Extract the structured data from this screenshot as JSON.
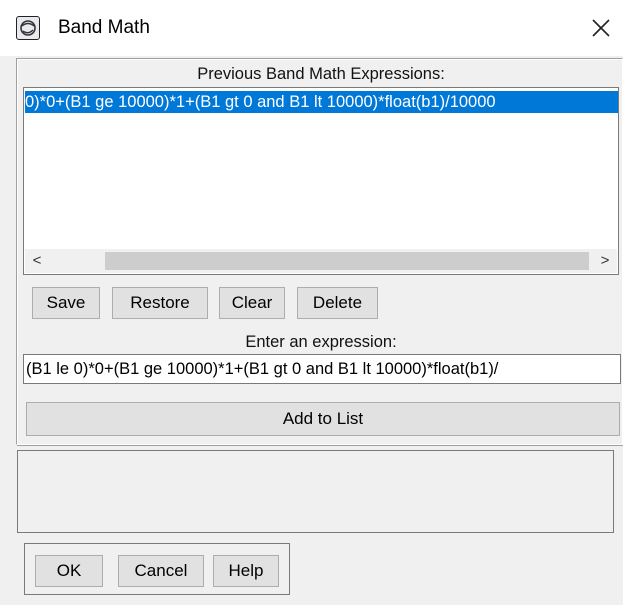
{
  "window": {
    "title": "Band Math",
    "icons": {
      "app": "band-math-app-icon",
      "close": "close-icon"
    }
  },
  "history": {
    "label": "Previous Band Math Expressions:",
    "items": [
      "0)*0+(B1 ge 10000)*1+(B1 gt 0 and B1 lt 10000)*float(b1)/10000"
    ],
    "selected_index": 0
  },
  "scrollbar": {
    "left_arrow": "<",
    "right_arrow": ">"
  },
  "history_buttons": {
    "save": "Save",
    "restore": "Restore",
    "clear": "Clear",
    "delete": "Delete"
  },
  "expression": {
    "label": "Enter an expression:",
    "value": "(B1 le 0)*0+(B1 ge 10000)*1+(B1 gt 0 and B1 lt 10000)*float(b1)/"
  },
  "add_to_list": "Add to List",
  "dialog_buttons": {
    "ok": "OK",
    "cancel": "Cancel",
    "help": "Help"
  },
  "colors": {
    "selection": "#0078d7",
    "button_face": "#e1e1e1",
    "dialog_bg": "#f0f0f0"
  }
}
